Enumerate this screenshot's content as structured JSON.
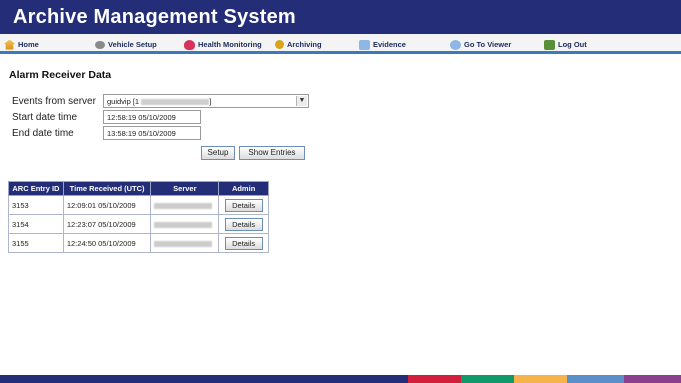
{
  "app": {
    "title": "Archive Management System"
  },
  "nav": [
    {
      "label": "Home",
      "icon": "home-icon"
    },
    {
      "label": "Vehicle Setup",
      "icon": "vehicle-icon"
    },
    {
      "label": "Health Monitoring",
      "icon": "health-icon"
    },
    {
      "label": "Archiving",
      "icon": "archiving-icon"
    },
    {
      "label": "Evidence",
      "icon": "evidence-icon"
    },
    {
      "label": "Go To Viewer",
      "icon": "viewer-icon"
    },
    {
      "label": "Log Out",
      "icon": "logout-icon"
    }
  ],
  "page": {
    "title": "Alarm Receiver Data"
  },
  "form": {
    "events_label": "Events from server",
    "events_value_prefix": "guidvip [1",
    "events_value_suffix": "]",
    "start_label": "Start date time",
    "start_value": "12:58:19 05/10/2009",
    "end_label": "End date time",
    "end_value": "13:58:19 05/10/2009",
    "setup_label": "Setup",
    "show_entries_label": "Show Entries"
  },
  "table": {
    "headers": [
      "ARC Entry ID",
      "Time Received (UTC)",
      "Server",
      "Admin"
    ],
    "rows": [
      {
        "id": "3153",
        "time": "12:09:01 05/10/2009",
        "server": "",
        "action": "Details"
      },
      {
        "id": "3154",
        "time": "12:23:07 05/10/2009",
        "server": "",
        "action": "Details"
      },
      {
        "id": "3155",
        "time": "12:24:50 05/10/2009",
        "server": "",
        "action": "Details"
      }
    ]
  },
  "colors": {
    "header_bg": "#232d78",
    "nav_accent": "#3b79b8",
    "footer_bars": [
      "#232d78",
      "#d21f3c",
      "#0e9a6b",
      "#f5b34a",
      "#5b8fc9",
      "#8a3f8f"
    ]
  }
}
